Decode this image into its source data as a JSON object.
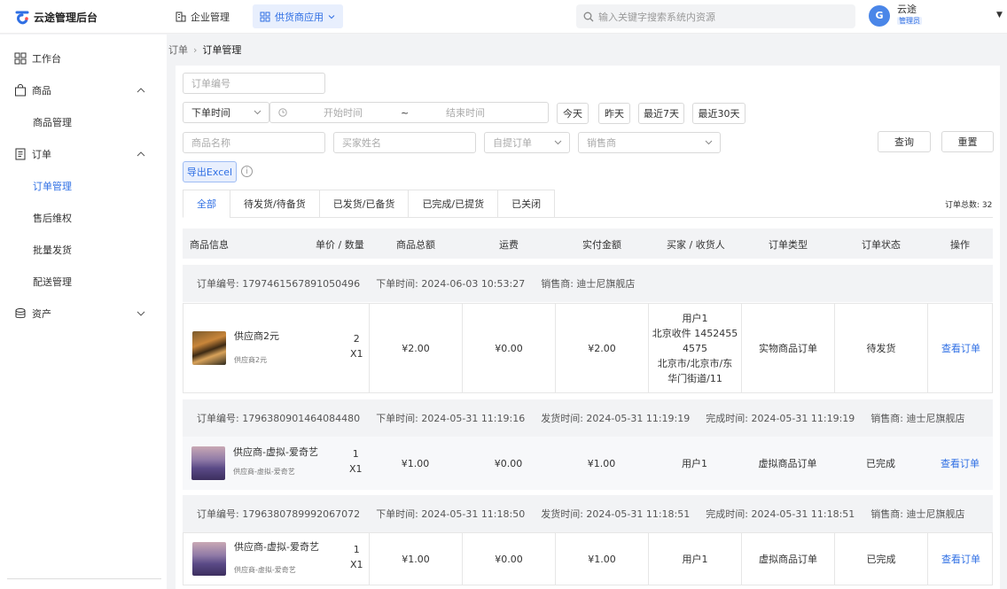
{
  "app": {
    "title": "云途管理后台"
  },
  "topnav": [
    {
      "label": "企业管理",
      "icon": "building-icon"
    },
    {
      "label": "供货商应用",
      "icon": "grid-app-icon"
    }
  ],
  "search": {
    "placeholder": "输入关键字搜索系统内资源"
  },
  "user": {
    "avatar": "G",
    "name": "云途",
    "role": "管理员"
  },
  "sidebar": {
    "items": [
      {
        "label": "工作台",
        "icon": "dashboard-icon"
      },
      {
        "label": "商品",
        "icon": "bag-icon"
      },
      {
        "label": "商品管理"
      },
      {
        "label": "订单",
        "icon": "order-icon"
      },
      {
        "label": "订单管理"
      },
      {
        "label": "售后维权"
      },
      {
        "label": "批量发货"
      },
      {
        "label": "配送管理"
      },
      {
        "label": "资产",
        "icon": "asset-icon"
      }
    ]
  },
  "breadcrumb": {
    "parent": "订单",
    "current": "订单管理"
  },
  "filters": {
    "order_no_placeholder": "订单编号",
    "time_type": "下单时间",
    "start_placeholder": "开始时间",
    "range_sep": "~",
    "end_placeholder": "结束时间",
    "quick": [
      "今天",
      "昨天",
      "最近7天",
      "最近30天"
    ],
    "product_placeholder": "商品名称",
    "buyer_placeholder": "买家姓名",
    "pickup_placeholder": "自提订单",
    "seller_placeholder": "销售商",
    "query": "查询",
    "reset": "重置",
    "export": "导出Excel",
    "info": "i"
  },
  "tabs": [
    "全部",
    "待发货/待备货",
    "已发货/已备货",
    "已完成/已提货",
    "已关闭"
  ],
  "total": "订单总数: 32",
  "columns": [
    "商品信息",
    "单价 / 数量",
    "商品总额",
    "运费",
    "实付金额",
    "买家 / 收货人",
    "订单类型",
    "订单状态",
    "操作"
  ],
  "orders": [
    {
      "meta": [
        "订单编号: 1797461567891050496",
        "下单时间: 2024-06-03 10:53:27",
        "销售商: 迪士尼旗舰店"
      ],
      "product": {
        "name": "供应商2元",
        "sub": "供应商2元",
        "qty": "2",
        "times": "X1",
        "thumb": "tiger"
      },
      "total": "¥2.00",
      "freight": "¥0.00",
      "paid": "¥2.00",
      "buyer": [
        "用户1",
        "北京收件 1452455",
        "4575",
        "北京市/北京市/东",
        "华门街道/11"
      ],
      "type": "实物商品订单",
      "status": "待发货",
      "action": "查看订单"
    },
    {
      "meta": [
        "订单编号: 1796380901464084480",
        "下单时间: 2024-05-31 11:19:16",
        "发货时间: 2024-05-31 11:19:19",
        "完成时间: 2024-05-31 11:19:19",
        "销售商: 迪士尼旗舰店"
      ],
      "product": {
        "name": "供应商-虚拟-爱奇艺",
        "sub": "供应商-虚拟-爱奇艺",
        "qty": "1",
        "times": "X1",
        "thumb": "lav"
      },
      "total": "¥1.00",
      "freight": "¥0.00",
      "paid": "¥1.00",
      "buyer": [
        "用户1"
      ],
      "type": "虚拟商品订单",
      "status": "已完成",
      "action": "查看订单"
    },
    {
      "meta": [
        "订单编号: 1796380789992067072",
        "下单时间: 2024-05-31 11:18:50",
        "发货时间: 2024-05-31 11:18:51",
        "完成时间: 2024-05-31 11:18:51",
        "销售商: 迪士尼旗舰店"
      ],
      "product": {
        "name": "供应商-虚拟-爱奇艺",
        "sub": "供应商-虚拟-爱奇艺",
        "qty": "1",
        "times": "X1",
        "thumb": "lav"
      },
      "total": "¥1.00",
      "freight": "¥0.00",
      "paid": "¥1.00",
      "buyer": [
        "用户1"
      ],
      "type": "虚拟商品订单",
      "status": "已完成",
      "action": "查看订单"
    }
  ],
  "colors": {
    "accent": "#2f6fe4",
    "accent_bg": "#e8effd",
    "bg": "#f2f3f5"
  }
}
